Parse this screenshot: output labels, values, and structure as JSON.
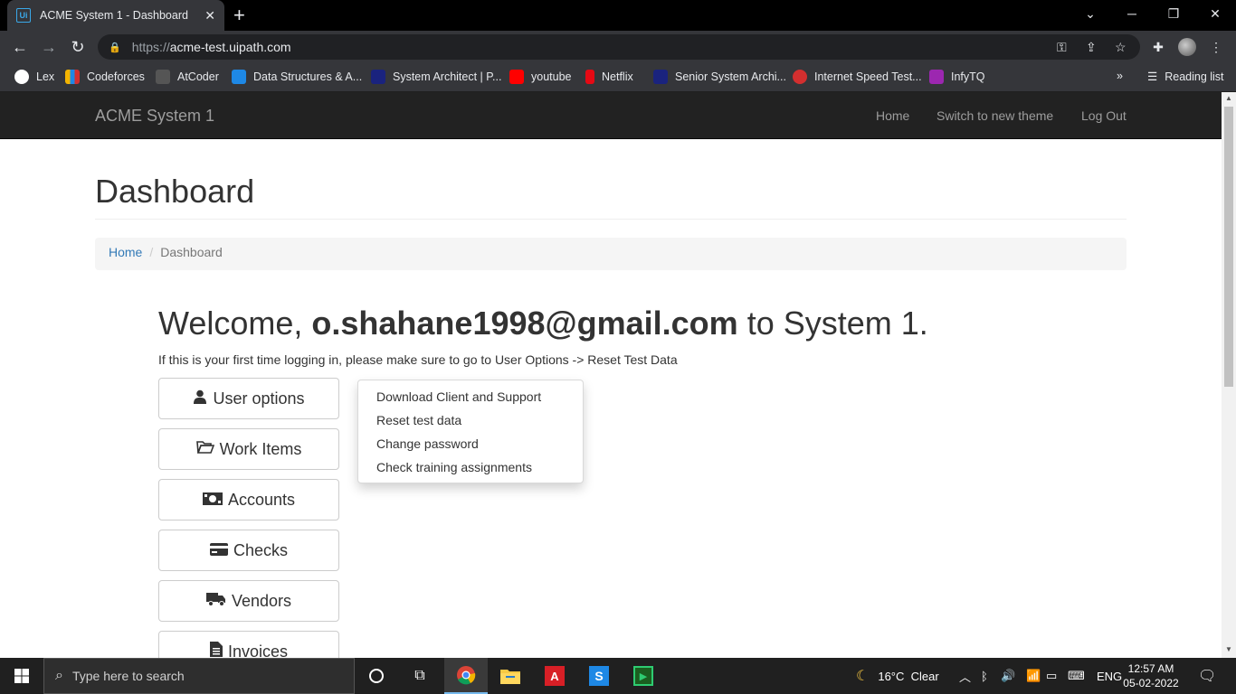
{
  "browser": {
    "tab_title": "ACME System 1 - Dashboard",
    "tab_favicon_text": "Ui",
    "url_scheme": "https://",
    "url_host": "acme-test.uipath.com",
    "bookmarks": [
      {
        "label": "Lex",
        "color": "#ffffff"
      },
      {
        "label": "Codeforces",
        "color": "#f4b400"
      },
      {
        "label": "AtCoder",
        "color": "#555555"
      },
      {
        "label": "Data Structures & A...",
        "color": "#1e88e5"
      },
      {
        "label": "System Architect | P...",
        "color": "#1a237e"
      },
      {
        "label": "youtube",
        "color": "#ff0000"
      },
      {
        "label": "Netflix",
        "color": "#e50914"
      },
      {
        "label": "Senior System Archi...",
        "color": "#1a237e"
      },
      {
        "label": "Internet Speed Test...",
        "color": "#d32f2f"
      },
      {
        "label": "InfyTQ",
        "color": "#9c27b0"
      }
    ],
    "reading_list": "Reading list"
  },
  "navbar": {
    "brand": "ACME System 1",
    "links": [
      "Home",
      "Switch to new theme",
      "Log Out"
    ]
  },
  "page": {
    "title": "Dashboard",
    "breadcrumb": {
      "home": "Home",
      "current": "Dashboard"
    },
    "welcome_prefix": "Welcome, ",
    "welcome_user": "o.shahane1998@gmail.com",
    "welcome_suffix": " to System 1.",
    "hint": "If this is your first time logging in, please make sure to go to User Options -> Reset Test Data"
  },
  "menu_buttons": [
    {
      "label": "User options",
      "icon": "user-icon"
    },
    {
      "label": "Work Items",
      "icon": "folder-open-icon"
    },
    {
      "label": "Accounts",
      "icon": "money-icon"
    },
    {
      "label": "Checks",
      "icon": "credit-card-icon"
    },
    {
      "label": "Vendors",
      "icon": "truck-icon"
    },
    {
      "label": "Invoices",
      "icon": "file-text-icon"
    }
  ],
  "dropdown": [
    "Download Client and Support",
    "Reset test data",
    "Change password",
    "Check training assignments"
  ],
  "taskbar": {
    "search_placeholder": "Type here to search",
    "weather": "16°C  Clear",
    "language": "ENG",
    "time": "12:57 AM",
    "date": "05-02-2022"
  }
}
